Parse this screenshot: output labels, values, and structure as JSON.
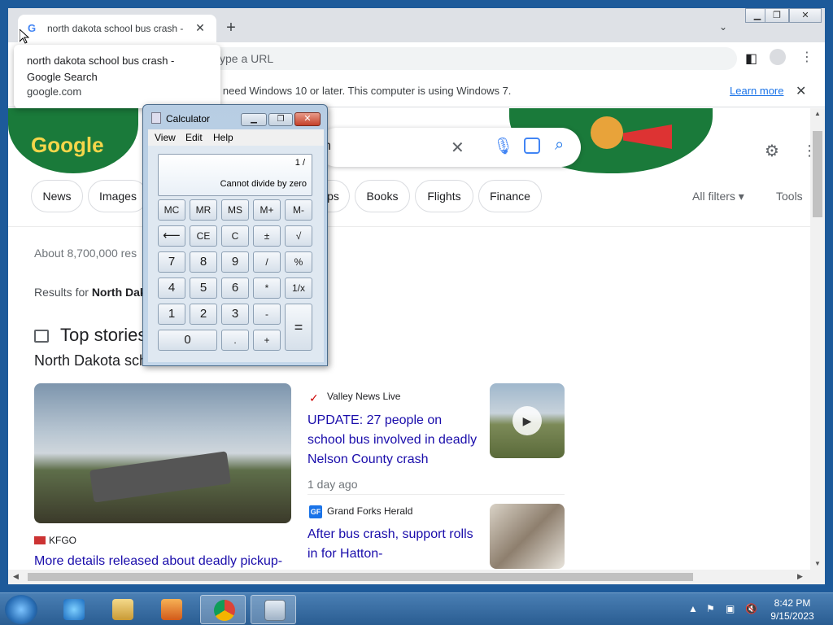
{
  "chrome": {
    "tab_title": "north dakota school bus crash - Google Search",
    "new_tab": "+",
    "omnibox_placeholder": "ype a URL",
    "infobar_message": "'ll need Windows 10 or later. This computer is using Windows 7.",
    "infobar_link": "Learn more",
    "tooltip_title": "north dakota school bus crash - Google Search",
    "tooltip_domain": "google.com"
  },
  "google": {
    "logo": "Google",
    "query": "h",
    "chips": [
      "News",
      "Images",
      "ps",
      "Books",
      "Flights",
      "Finance"
    ],
    "all_filters": "All filters",
    "tools": "Tools",
    "stats": "About 8,700,000 res",
    "results_for_prefix": "Results for ",
    "results_for_bold": "North Dak",
    "top_stories": "Top stories",
    "top_stories_sub": "North Dakota sch",
    "stories": [
      {
        "source": "KFGO",
        "headline": "More details released about deadly pickup-"
      },
      {
        "source": "Valley News Live",
        "headline": "UPDATE: 27 people on school bus involved in deadly Nelson County crash",
        "time": "1 day ago"
      },
      {
        "source": "Grand Forks Herald",
        "source_badge": "GF",
        "headline": "After bus crash, support rolls in for Hatton-"
      }
    ]
  },
  "calculator": {
    "title": "Calculator",
    "menu": [
      "View",
      "Edit",
      "Help"
    ],
    "display_expr": "1 /",
    "display_result": "Cannot divide by zero",
    "keys": {
      "row1": [
        "MC",
        "MR",
        "MS",
        "M+",
        "M-"
      ],
      "row2": [
        "⟵",
        "CE",
        "C",
        "±",
        "√"
      ],
      "row3": [
        "7",
        "8",
        "9",
        "/",
        "%"
      ],
      "row4": [
        "4",
        "5",
        "6",
        "*",
        "1/x"
      ],
      "row5": [
        "1",
        "2",
        "3",
        "-"
      ],
      "row6": [
        "0",
        ".",
        "+"
      ],
      "equals": "="
    }
  },
  "taskbar": {
    "time": "8:42 PM",
    "date": "9/15/2023"
  },
  "colors": {
    "link": "#1a0dab",
    "accent": "#1a73e8",
    "doodle_green": "#1a7a3a"
  }
}
